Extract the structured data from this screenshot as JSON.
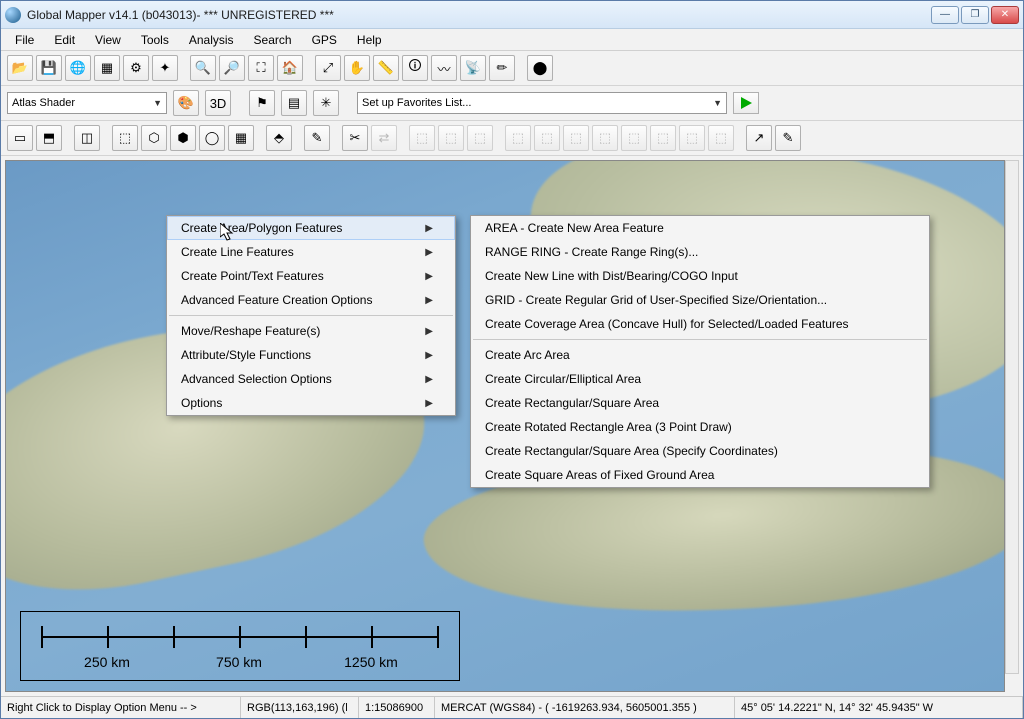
{
  "window": {
    "title": "Global Mapper v14.1 (b043013)- *** UNREGISTERED ***"
  },
  "menu": [
    "File",
    "Edit",
    "View",
    "Tools",
    "Analysis",
    "Search",
    "GPS",
    "Help"
  ],
  "shader_combo": "Atlas Shader",
  "favorites_combo": "Set up Favorites List...",
  "context_menu": {
    "items": [
      {
        "label": "Create Area/Polygon Features",
        "sub": true,
        "hover": true
      },
      {
        "label": "Create Line Features",
        "sub": true
      },
      {
        "label": "Create Point/Text Features",
        "sub": true
      },
      {
        "label": "Advanced Feature Creation Options",
        "sub": true
      }
    ],
    "items2": [
      {
        "label": "Move/Reshape Feature(s)",
        "sub": true
      },
      {
        "label": "Attribute/Style Functions",
        "sub": true
      },
      {
        "label": "Advanced Selection Options",
        "sub": true
      },
      {
        "label": "Options",
        "sub": true
      }
    ]
  },
  "submenu": {
    "group1": [
      "AREA - Create New Area Feature",
      "RANGE RING - Create Range Ring(s)...",
      "Create New Line with Dist/Bearing/COGO Input",
      "GRID - Create Regular Grid of User-Specified Size/Orientation...",
      "Create Coverage Area (Concave Hull) for Selected/Loaded Features"
    ],
    "group2": [
      "Create Arc Area",
      "Create Circular/Elliptical Area",
      "Create Rectangular/Square Area",
      "Create Rotated Rectangle Area (3 Point Draw)",
      "Create Rectangular/Square Area (Specify Coordinates)",
      "Create Square Areas of Fixed Ground Area"
    ]
  },
  "scale": {
    "labels": [
      "250 km",
      "750 km",
      "1250 km"
    ]
  },
  "status": {
    "hint": "Right Click to Display Option Menu -- >",
    "rgb": "RGB(113,163,196) (l",
    "scale": "1:15086900",
    "proj": "MERCAT (WGS84) - ( -1619263.934, 5605001.355 )",
    "coord": "45° 05' 14.2221\" N, 14° 32' 45.9435\" W"
  },
  "icons": {
    "row1": [
      "open",
      "save",
      "globe",
      "layer",
      "config",
      "measure",
      "",
      "zoom-in",
      "zoom-out",
      "zoom-sel",
      "home",
      "",
      "full",
      "pan",
      "grid",
      "info",
      "vector",
      "tower",
      "draw",
      "",
      "record"
    ],
    "row2": [
      "shader1",
      "shader2",
      "",
      "flag",
      "layer2",
      "net",
      "",
      ""
    ],
    "row3": [
      "d1",
      "d2",
      "",
      "d3",
      "",
      "d4",
      "d5",
      "d6",
      "d7",
      "d8",
      "d9",
      "",
      "d10",
      "",
      "d11",
      "",
      "d12",
      "d13",
      "",
      "d14",
      "d15",
      "d16",
      "",
      "d17",
      "d18",
      "d19",
      "d20",
      "d21",
      "d22",
      "d23",
      "d24",
      "",
      "d25",
      "d26"
    ]
  },
  "colors": {
    "disabled": "#b8b8b8"
  }
}
